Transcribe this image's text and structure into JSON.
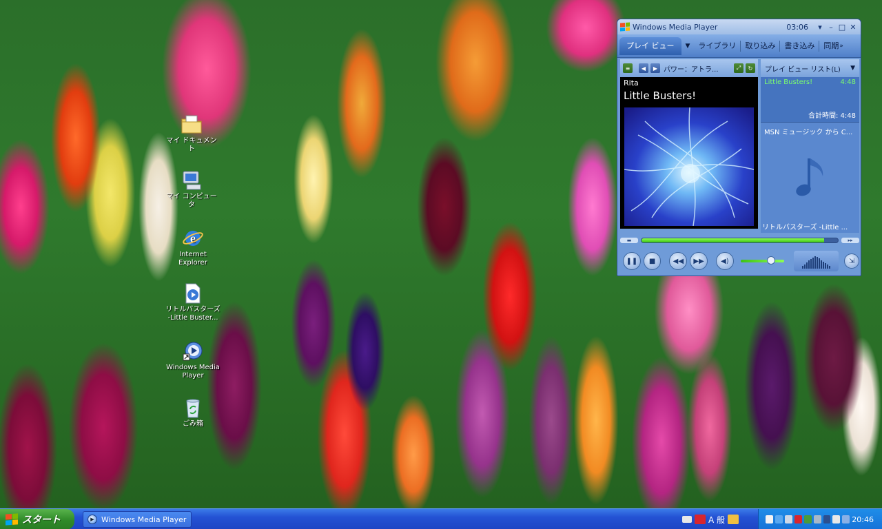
{
  "desktop": {
    "icons": [
      {
        "label": "マイ ドキュメント",
        "icon": "folder-document-icon"
      },
      {
        "label": "マイ コンピュータ",
        "icon": "computer-icon"
      },
      {
        "label": "Internet Explorer",
        "icon": "internet-explorer-icon"
      },
      {
        "label": "リトルバスターズ -Little Buster...",
        "icon": "media-file-icon"
      },
      {
        "label": "Windows Media Player",
        "icon": "windows-media-player-icon"
      },
      {
        "label": "ごみ箱",
        "icon": "recycle-bin-icon"
      }
    ]
  },
  "wmp": {
    "title": "Windows Media Player",
    "time": "03:06",
    "tabs": [
      "プレイ ビュー",
      "ライブラリ",
      "取り込み",
      "書き込み",
      "同期"
    ],
    "visualization": "パワー：アトラ...",
    "now_playing": {
      "artist": "Rita",
      "title": "Little Busters!"
    },
    "playlist": {
      "header": "プレイ ビュー リスト(L)",
      "items": [
        {
          "name": "Little Busters!",
          "duration": "4:48"
        }
      ],
      "total": "合計時間: 4:48"
    },
    "msn": "MSN ミュージック から C...",
    "album": "リトルバスターズ -Little ...",
    "seek_progress": 0.93,
    "volume": 0.7,
    "colors": {
      "accent": "#3ec214",
      "frame": "#6f9bd8"
    }
  },
  "taskbar": {
    "start_label": "スタート",
    "task": "Windows Media Player",
    "ime": "A 般",
    "clock": "20:46"
  }
}
